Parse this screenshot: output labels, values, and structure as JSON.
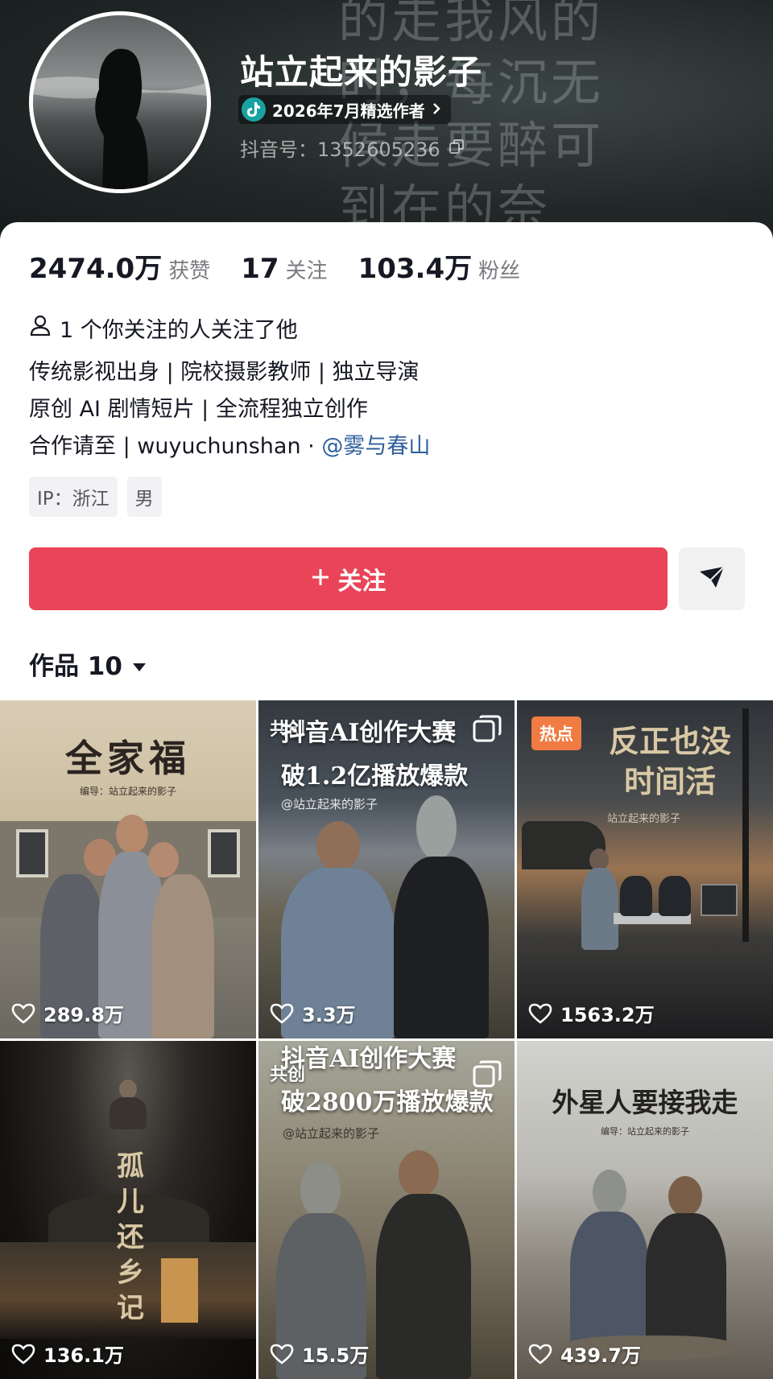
{
  "header": {
    "nickname": "站立起来的影子",
    "creator_badge": "2026年7月精选作者",
    "douyin_id_label": "抖音号：",
    "douyin_id": "1352605236",
    "background_calligraphy": "的走我风的\n时，每沉无\n候走要醉可\n到在的奈"
  },
  "stats": [
    {
      "value": "2474.0万",
      "label": "获赞"
    },
    {
      "value": "17",
      "label": "关注"
    },
    {
      "value": "103.4万",
      "label": "粉丝"
    }
  ],
  "mutual": "1 个你关注的人关注了他",
  "bio": {
    "line1": "传统影视出身 | 院校摄影教师 | 独立导演",
    "line2": "原创 AI 剧情短片 | 全流程独立创作",
    "line3_prefix": "合作请至 |  wuyuchunshan · ",
    "line3_mention": "@雾与春山"
  },
  "tags": [
    "IP：浙江",
    "男"
  ],
  "actions": {
    "follow_label": "关注",
    "follow_icon": "plus-icon",
    "share_icon": "send-icon"
  },
  "works_tab": {
    "label": "作品 10"
  },
  "videos": [
    {
      "title": "全家福",
      "subtitle": "编导：站立起来的影子",
      "likes": "289.8万",
      "corner": "",
      "hot": ""
    },
    {
      "title": "抖音AI创作大赛\n破1.2亿播放爆款",
      "subtitle": "@站立起来的影子",
      "likes": "3.3万",
      "corner": "共创",
      "hot": ""
    },
    {
      "title": "反正也没\n时间活",
      "subtitle": "站立起来的影子",
      "likes": "1563.2万",
      "corner": "",
      "hot": "热点"
    },
    {
      "title": "孤\n儿\n还\n乡\n记",
      "subtitle": "",
      "likes": "136.1万",
      "corner": "",
      "hot": ""
    },
    {
      "title": "抖音AI创作大赛\n破2800万播放爆款",
      "subtitle": "@站立起来的影子",
      "likes": "15.5万",
      "corner": "共创",
      "hot": ""
    },
    {
      "title": "外星人要接我走",
      "subtitle": "编导：站立起来的影子",
      "likes": "439.7万",
      "corner": "",
      "hot": ""
    }
  ],
  "colors": {
    "follow_button": "#ea4458",
    "mention": "#2f5f9c",
    "hot_badge": "#f07b43"
  }
}
